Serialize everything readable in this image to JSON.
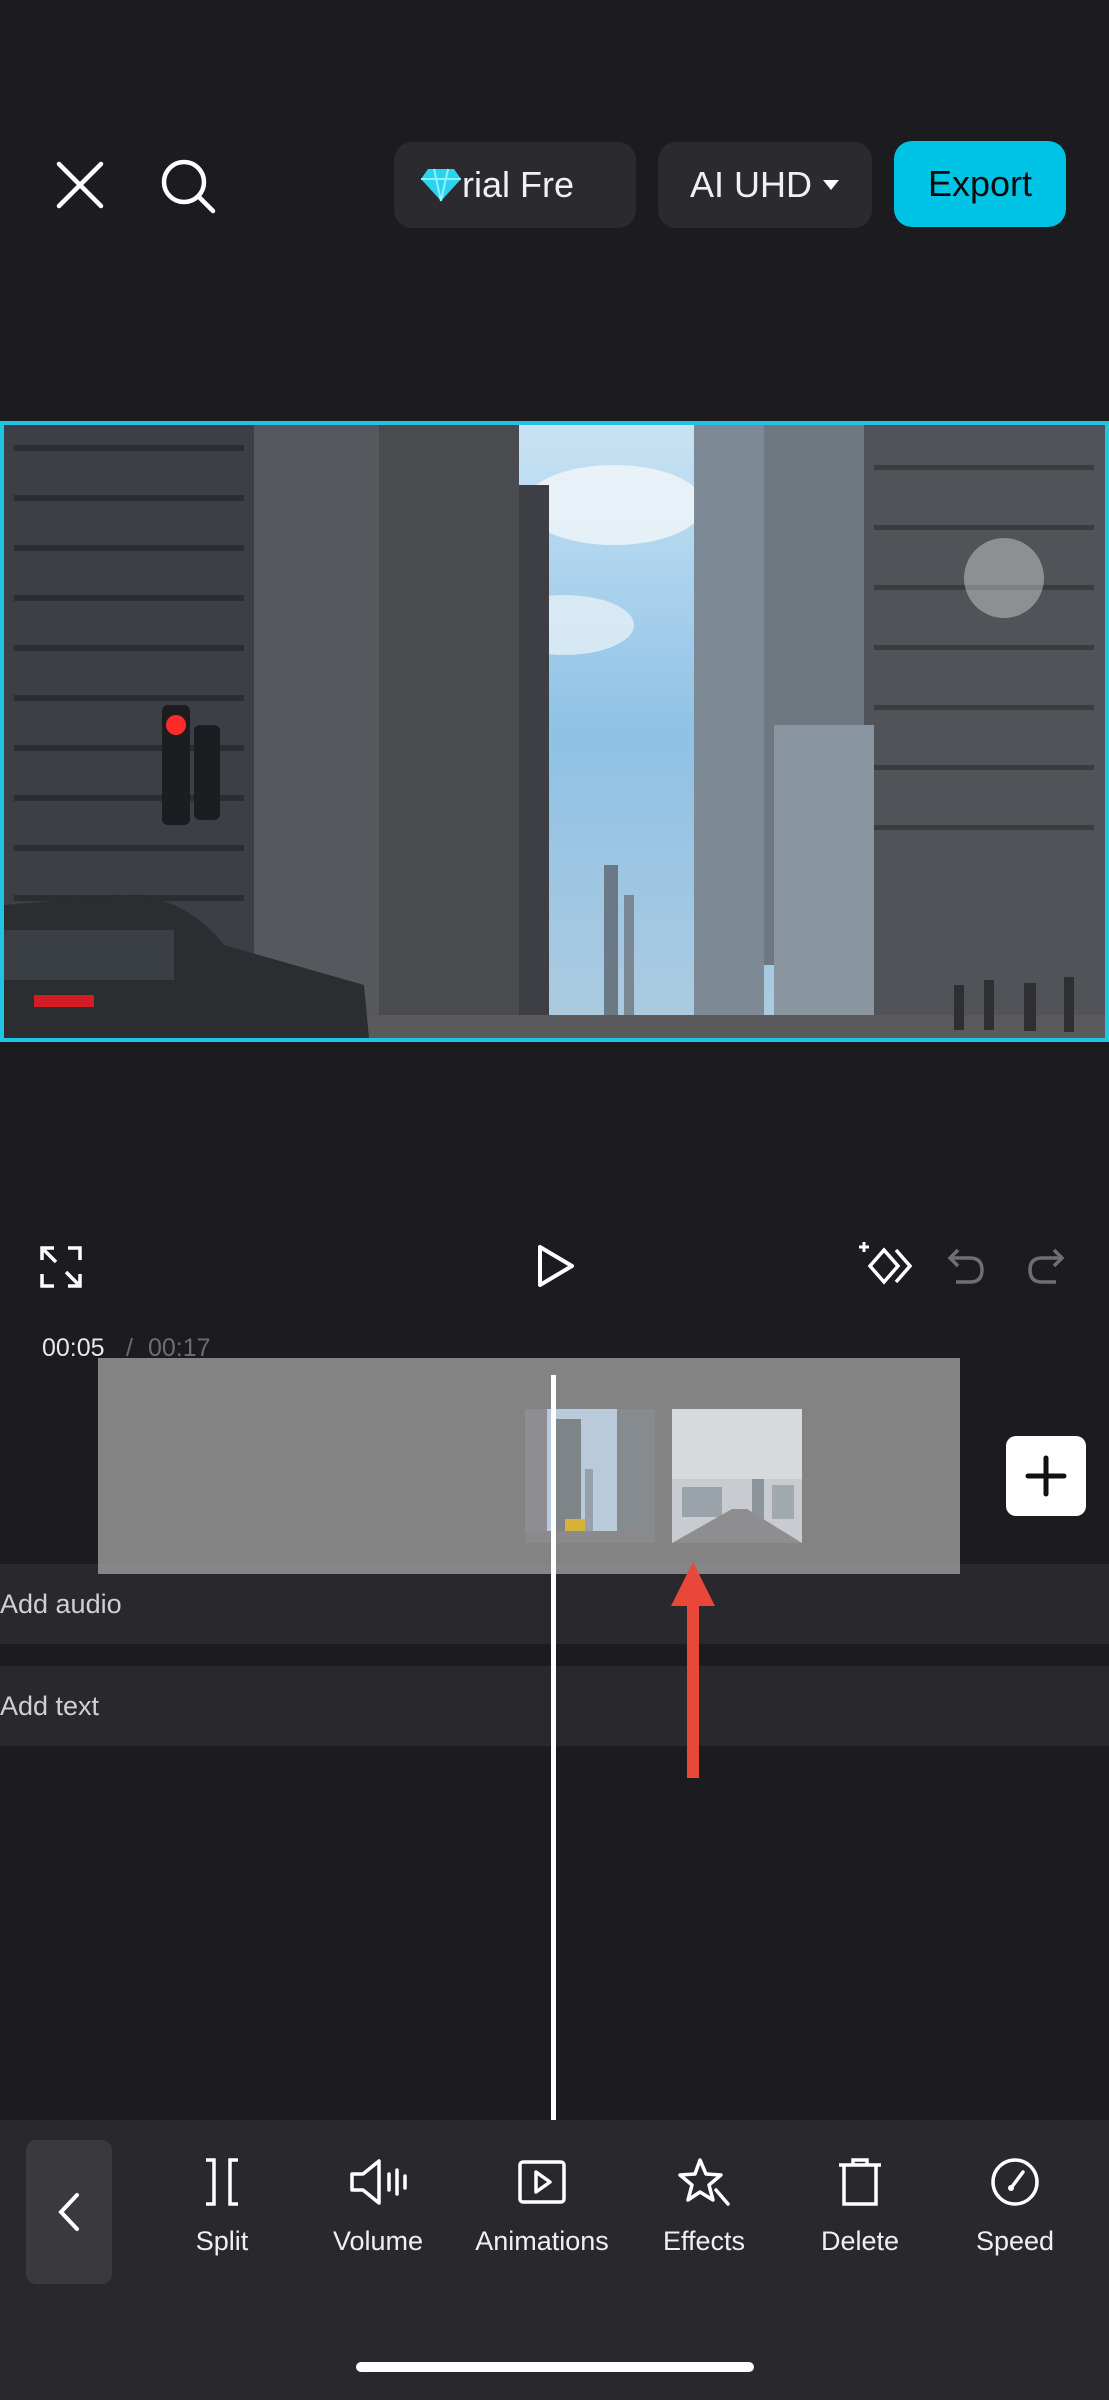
{
  "topbar": {
    "trial_text": "rial   Fre",
    "uhd_label": "AI UHD",
    "export_label": "Export"
  },
  "timeline": {
    "current_time": "00:05",
    "separator": "/",
    "total_time": "00:17",
    "audio_lane_label": "Add audio",
    "text_lane_label": "Add text"
  },
  "toolbar": {
    "items": [
      {
        "label": "Split"
      },
      {
        "label": "Volume"
      },
      {
        "label": "Animations"
      },
      {
        "label": "Effects"
      },
      {
        "label": "Delete"
      },
      {
        "label": "Speed"
      }
    ]
  },
  "colors": {
    "accent": "#00c4e6",
    "arrow": "#e8473a",
    "background": "#1c1b1f"
  }
}
